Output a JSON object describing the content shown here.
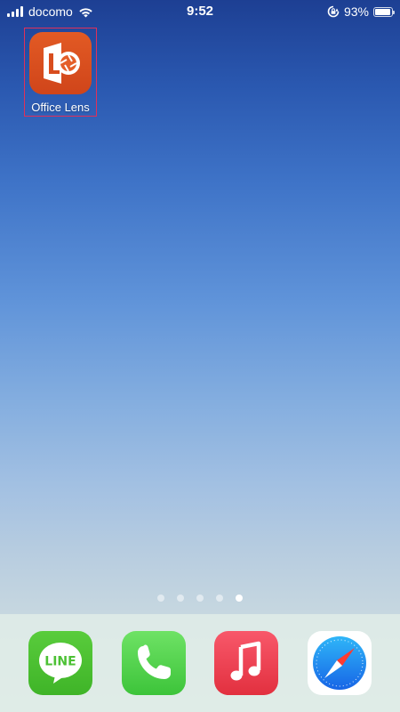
{
  "status_bar": {
    "carrier": "docomo",
    "time": "9:52",
    "battery_percent": "93%",
    "battery_level": 0.93
  },
  "home_screen": {
    "apps": [
      {
        "label": "Office Lens",
        "icon": "office-lens-icon",
        "color": "#d84d1e"
      }
    ],
    "page_count": 5,
    "active_page": 5
  },
  "dock": {
    "apps": [
      {
        "icon": "line-icon",
        "icon_text": "LINE",
        "color": "#4cc134"
      },
      {
        "icon": "phone-icon",
        "color": "#4fd34a"
      },
      {
        "icon": "music-icon",
        "color": "#f0404f"
      },
      {
        "icon": "safari-icon",
        "color": "#1a8cf0"
      }
    ]
  },
  "colors": {
    "wallpaper_top": "#1d3f93",
    "wallpaper_bottom": "#d3e1e2",
    "selection_border": "#e0305a"
  }
}
